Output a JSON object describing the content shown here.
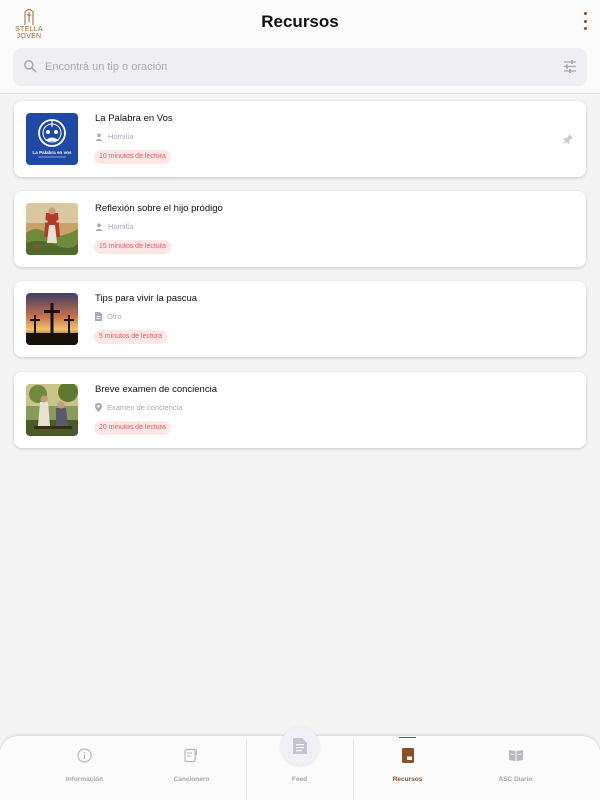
{
  "header": {
    "title": "Recursos",
    "logo_text_1": "STELLA",
    "logo_text_2": "JOVEN",
    "menu_icon": "more-vertical-icon"
  },
  "search": {
    "placeholder": "Encontrá un tip o oración",
    "value": "",
    "icon": "search-icon",
    "filter_icon": "tune-icon"
  },
  "resources": [
    {
      "title": "La Palabra en Vos",
      "type": "Homilía",
      "type_icon": "person-icon",
      "read_time": "10 minutos de lectura",
      "pinned": true,
      "thumb_text": "La Palabra en vos"
    },
    {
      "title": "Reflexión sobre el hijo pródigo",
      "type": "Homilía",
      "type_icon": "person-icon",
      "read_time": "15 minutos de lectura",
      "pinned": false
    },
    {
      "title": "Tips para vivir la pascua",
      "type": "Otro",
      "type_icon": "document-icon",
      "read_time": "5 minutos de lectura",
      "pinned": false
    },
    {
      "title": "Breve examen de conciencia",
      "type": "Examen de conciencia",
      "type_icon": "location-pin-icon",
      "read_time": "20 minutos de lectura",
      "pinned": false
    }
  ],
  "tabs": [
    {
      "label": "Información",
      "icon": "info-icon",
      "active": false
    },
    {
      "label": "Cancionero",
      "icon": "songbook-icon",
      "active": false
    },
    {
      "label": "Feed",
      "icon": "feed-icon",
      "active": false
    },
    {
      "label": "Recursos",
      "icon": "book-icon",
      "active": true
    },
    {
      "label": "ASC Diario",
      "icon": "open-book-icon",
      "active": false
    }
  ],
  "colors": {
    "accent": "#8a4f24",
    "badge_bg": "#fde7e7",
    "badge_text": "#e45b5b",
    "muted": "#a9a9b8"
  }
}
